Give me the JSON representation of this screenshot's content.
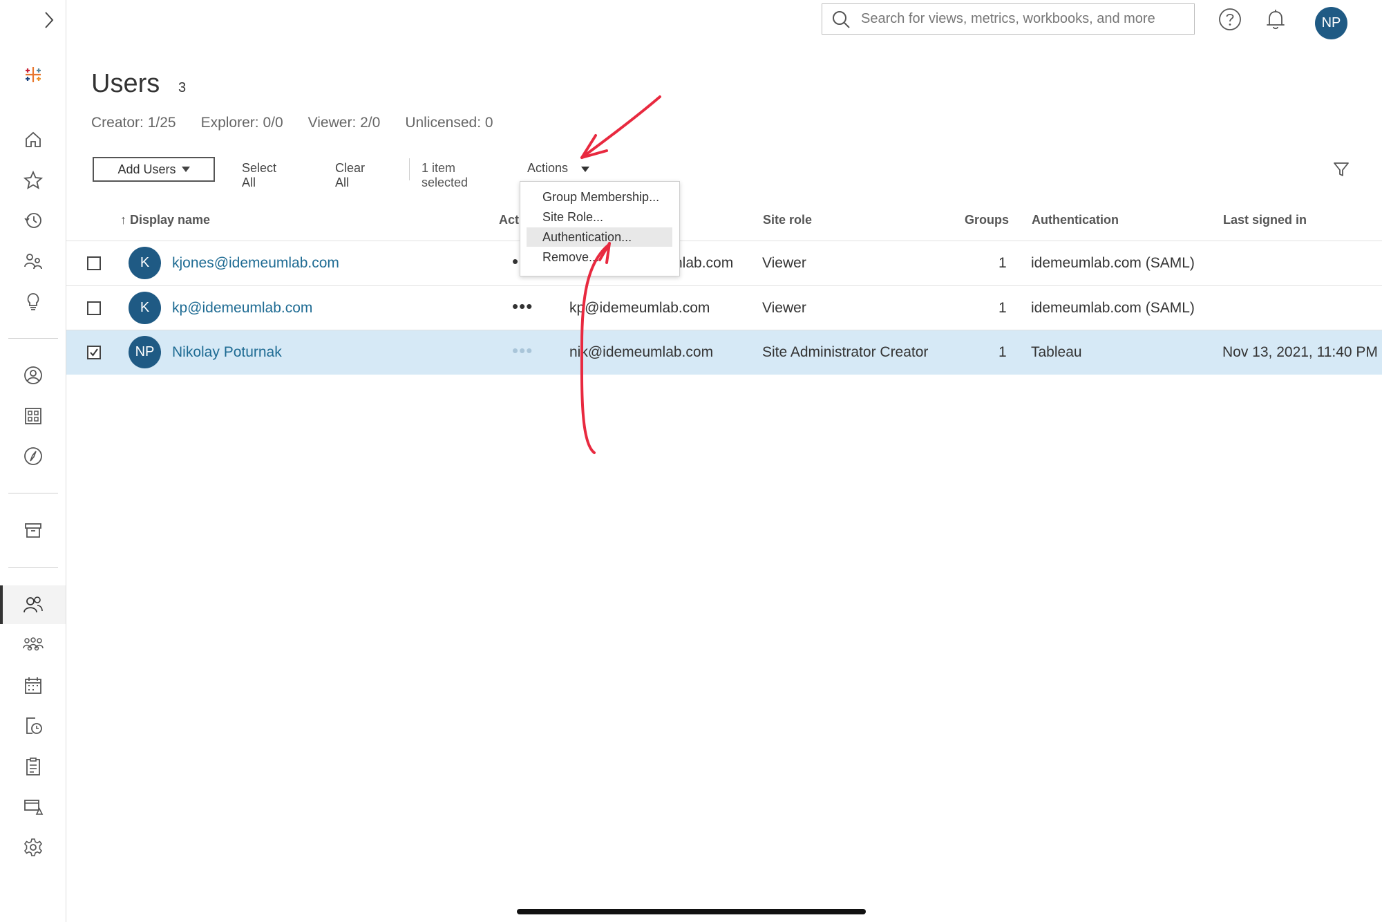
{
  "search": {
    "placeholder": "Search for views, metrics, workbooks, and more"
  },
  "user": {
    "initials": "NP"
  },
  "page": {
    "title": "Users",
    "count": "3"
  },
  "stats": [
    "Creator: 1/25",
    "Explorer: 0/0",
    "Viewer: 2/0",
    "Unlicensed: 0"
  ],
  "toolbar": {
    "add_users": "Add Users",
    "select_all": "Select All",
    "clear_all": "Clear All",
    "selected": "1 item selected",
    "actions": "Actions"
  },
  "actions_menu": [
    "Group Membership...",
    "Site Role...",
    "Authentication...",
    "Remove..."
  ],
  "table": {
    "columns": {
      "display_name": "Display name",
      "actions": "Acti",
      "site_role": "Site role",
      "groups": "Groups",
      "authentication": "Authentication",
      "last_signed_in": "Last signed in"
    },
    "rows": [
      {
        "initials": "K",
        "display_name": "kjones@idemeumlab.com",
        "more": "•••",
        "username": "nlab.com",
        "site_role": "Viewer",
        "groups": "1",
        "authentication": "idemeumlab.com (SAML)",
        "last_signed_in": ""
      },
      {
        "initials": "K",
        "display_name": "kp@idemeumlab.com",
        "more": "•••",
        "username": "kp@idemeumlab.com",
        "site_role": "Viewer",
        "groups": "1",
        "authentication": "idemeumlab.com (SAML)",
        "last_signed_in": ""
      },
      {
        "initials": "NP",
        "display_name": "Nikolay Poturnak",
        "more": "•••",
        "username": "nik@idemeumlab.com",
        "site_role": "Site Administrator Creator",
        "groups": "1",
        "authentication": "Tableau",
        "last_signed_in": "Nov 13, 2021, 11:40 PM"
      }
    ]
  },
  "colors": {
    "accent": "#1f5a84",
    "link": "#1e6b93",
    "selected_row": "#d6e9f6",
    "annotation": "#e8293f"
  },
  "icons": [
    "chevron-right-icon",
    "tableau-logo-icon",
    "home-icon",
    "star-icon",
    "history-icon",
    "shared-icon",
    "lightbulb-icon",
    "user-circle-icon",
    "collections-icon",
    "explore-icon",
    "archive-icon",
    "users-icon",
    "groups-icon",
    "schedules-icon",
    "jobs-icon",
    "tasks-icon",
    "data-connections-icon",
    "settings-icon",
    "search-icon",
    "help-icon",
    "bell-icon",
    "filter-icon",
    "caret-down-icon",
    "checkbox-icon"
  ]
}
